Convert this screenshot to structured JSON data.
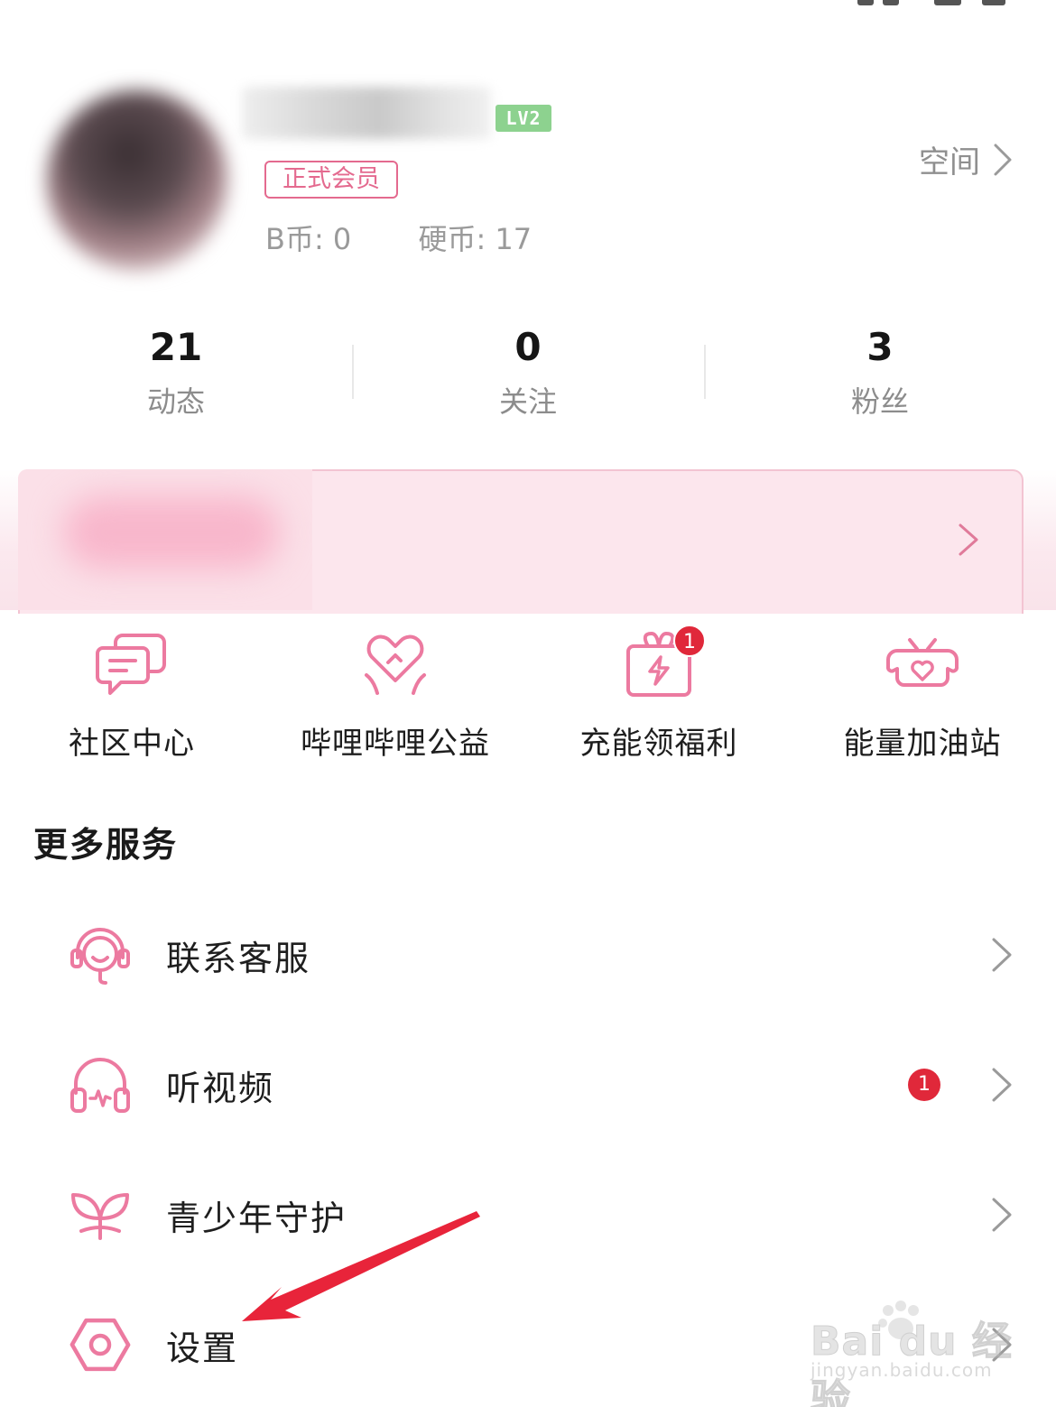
{
  "profile": {
    "level": "LV2",
    "member_tag": "正式会员",
    "b_coin": "B币: 0",
    "hard_coin": "硬币: 17",
    "space_label": "空间"
  },
  "stats": [
    {
      "value": "21",
      "label": "动态"
    },
    {
      "value": "0",
      "label": "关注"
    },
    {
      "value": "3",
      "label": "粉丝"
    }
  ],
  "tiles": [
    {
      "label": "社区中心",
      "icon": "chat-bubbles-icon"
    },
    {
      "label": "哔哩哔哩公益",
      "icon": "heart-hands-icon"
    },
    {
      "label": "充能领福利",
      "icon": "gift-charge-icon",
      "badge": "1"
    },
    {
      "label": "能量加油站",
      "icon": "tv-heart-icon"
    }
  ],
  "more_services": {
    "title": "更多服务",
    "items": [
      {
        "label": "联系客服",
        "icon": "headset-service-icon"
      },
      {
        "label": "听视频",
        "icon": "headphones-icon",
        "badge": "1"
      },
      {
        "label": "青少年守护",
        "icon": "sprout-icon"
      },
      {
        "label": "设置",
        "icon": "gear-hexagon-icon"
      }
    ]
  },
  "watermark": {
    "logo": "Bai du 经验",
    "url": "jingyan.baidu.com"
  },
  "colors": {
    "accent_pink": "#e46a8f",
    "badge_red": "#e0283a",
    "level_green": "#8dd28f",
    "banner_pink": "#fce6ed",
    "annotation_red": "#e8243a"
  }
}
